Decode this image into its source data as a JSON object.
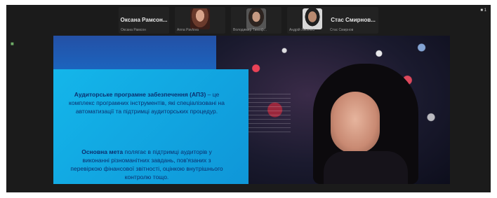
{
  "participants": [
    {
      "name": "Оксана Рамсон...",
      "caption": "Оксана Рамсон"
    },
    {
      "name": "",
      "caption": "Anna Pavlova"
    },
    {
      "name": "",
      "caption": "Володимир Тимоф..."
    },
    {
      "name": "",
      "caption": "Андрій Лисенко"
    },
    {
      "name": "Стас Смирнов...",
      "caption": "Стас Смирнов"
    }
  ],
  "strip_more": "1",
  "slide": {
    "para1_bold": "Аудиторське програмне забезпечення (АПЗ)",
    "para1_rest": " – це комплекс програмних інструментів, які спеціалізовані на автоматизації та підтримці аудиторських процедур.",
    "para2_bold": "Основна мета",
    "para2_rest": " полягає в підтримці аудиторів у виконанні різноманітних завдань, пов'язаних з перевіркою фінансової звітності, оцінкою внутрішнього контролю тощо."
  }
}
